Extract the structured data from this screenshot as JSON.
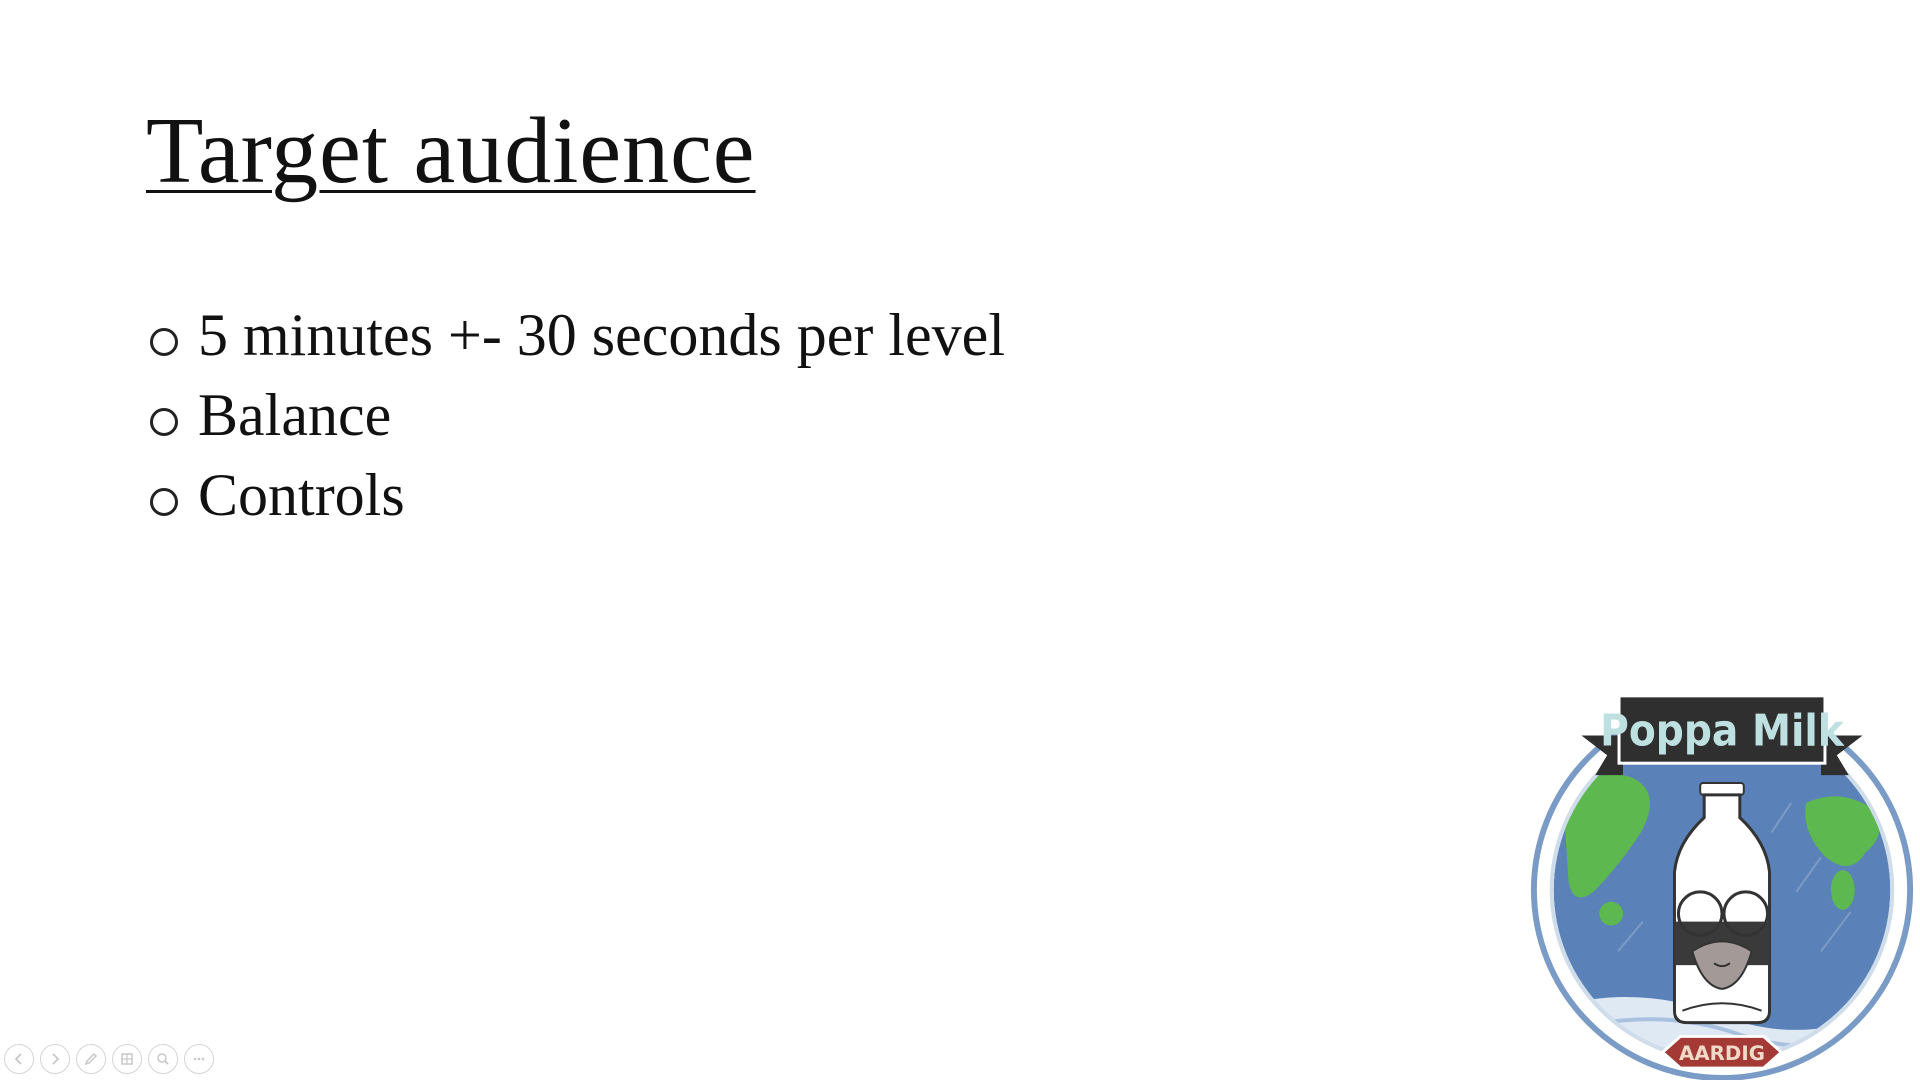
{
  "slide": {
    "title": "Target audience",
    "bullets": [
      "5 minutes +- 30 seconds per level",
      "Balance",
      "Controls"
    ]
  },
  "logo": {
    "banner_text": "Poppa Milk",
    "badge_text": "AARDIG",
    "colors": {
      "ocean": "#5b82b8",
      "land": "#5cb84f",
      "banner": "#2f2f2f",
      "banner_text": "#bfe0e0",
      "badge": "#a33a36"
    }
  },
  "toolbar": {
    "buttons": [
      {
        "name": "previous-slide-button",
        "icon": "arrow-left-icon"
      },
      {
        "name": "next-slide-button",
        "icon": "arrow-right-icon"
      },
      {
        "name": "pen-button",
        "icon": "pen-icon"
      },
      {
        "name": "see-all-slides-button",
        "icon": "slides-grid-icon"
      },
      {
        "name": "zoom-button",
        "icon": "magnifier-icon"
      },
      {
        "name": "more-options-button",
        "icon": "more-icon"
      }
    ]
  }
}
